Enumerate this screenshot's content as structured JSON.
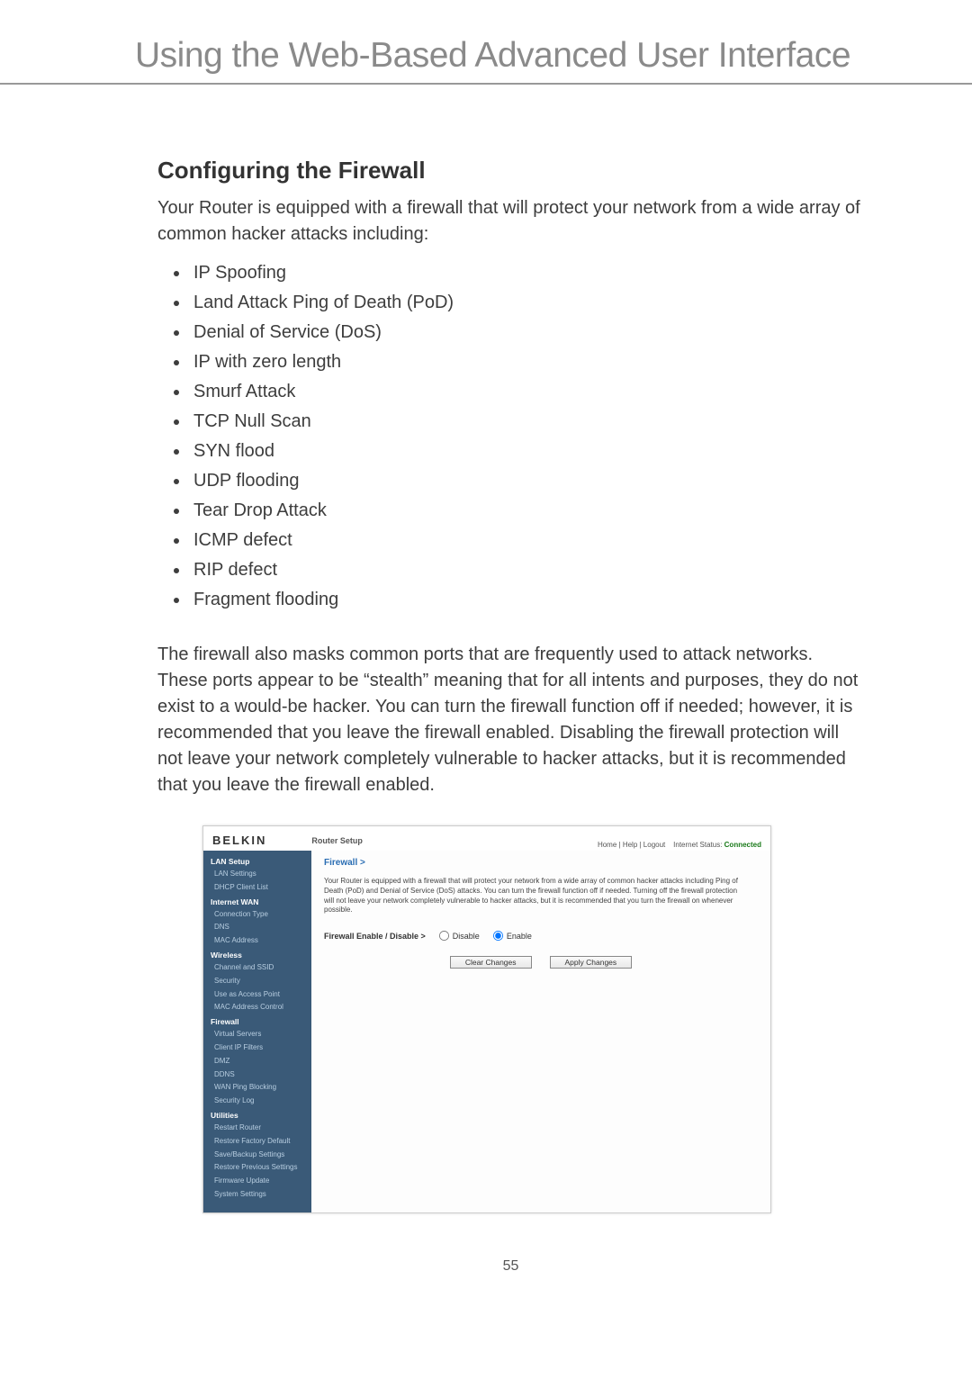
{
  "doc": {
    "page_title": "Using the Web-Based Advanced User Interface",
    "section_heading": "Configuring the Firewall",
    "intro_para": "Your Router is equipped with a firewall that will protect your network from a wide array of common hacker attacks including:",
    "attacks": [
      "IP Spoofing",
      "Land Attack Ping of Death (PoD)",
      "Denial of Service (DoS)",
      "IP with zero length",
      "Smurf Attack",
      "TCP Null Scan",
      "SYN flood",
      "UDP flooding",
      "Tear Drop Attack",
      "ICMP defect",
      "RIP defect",
      "Fragment flooding"
    ],
    "stealth_para": "The firewall also masks common ports that are frequently used to attack networks. These ports appear to be “stealth” meaning that for all intents and purposes, they do not exist to a would-be hacker. You can turn the firewall function off if needed; however, it is recommended that you leave the firewall enabled. Disabling the firewall protection will not leave your network completely vulnerable to hacker attacks, but it is recommended that you leave the firewall enabled.",
    "page_number": "55"
  },
  "router": {
    "brand": "BELKIN",
    "product": "Router Setup",
    "toplinks": {
      "home": "Home",
      "help": "Help",
      "logout": "Logout",
      "status_label": "Internet Status:",
      "status_value": "Connected"
    },
    "sidebar": {
      "groups": [
        {
          "title": "LAN Setup",
          "items": [
            "LAN Settings",
            "DHCP Client List"
          ]
        },
        {
          "title": "Internet WAN",
          "items": [
            "Connection Type",
            "DNS",
            "MAC Address"
          ]
        },
        {
          "title": "Wireless",
          "items": [
            "Channel and SSID",
            "Security",
            "Use as Access Point",
            "MAC Address Control"
          ]
        },
        {
          "title": "Firewall",
          "items": [
            "Virtual Servers",
            "Client IP Filters",
            "DMZ",
            "DDNS",
            "WAN Ping Blocking",
            "Security Log"
          ]
        },
        {
          "title": "Utilities",
          "items": [
            "Restart Router",
            "Restore Factory Default",
            "Save/Backup Settings",
            "Restore Previous Settings",
            "Firmware Update",
            "System Settings"
          ]
        }
      ]
    },
    "content": {
      "breadcrumb": "Firewall >",
      "description": "Your Router is equipped with a firewall that will protect your network from a wide array of common hacker attacks including Ping of Death (PoD) and Denial of Service (DoS) attacks. You can turn the firewall function off if needed. Turning off the firewall protection will not leave your network completely vulnerable to hacker attacks, but it is recommended that you turn the firewall on whenever possible.",
      "toggle_label": "Firewall Enable / Disable >",
      "opt_disable": "Disable",
      "opt_enable": "Enable",
      "selected": "enable",
      "btn_clear": "Clear Changes",
      "btn_apply": "Apply Changes"
    }
  }
}
